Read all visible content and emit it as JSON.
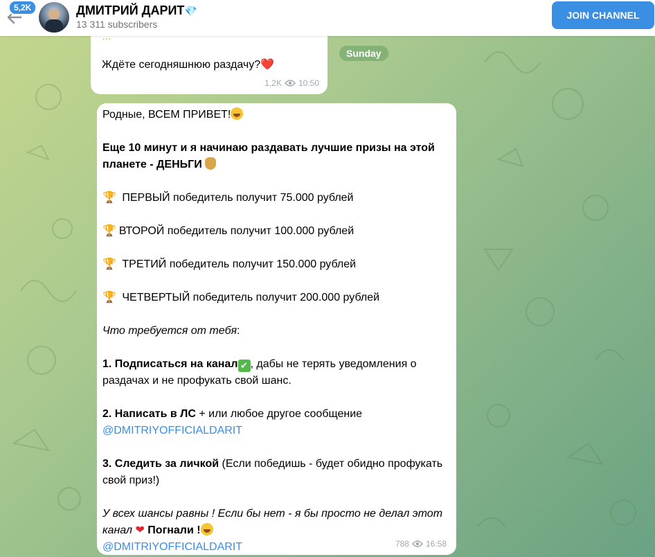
{
  "header": {
    "badge": "5,2K",
    "title": "ДМИТРИЙ ДАРИТ",
    "title_emoji": "💎",
    "subscribers": "13 311 subscribers",
    "join_label": "JOIN CHANNEL"
  },
  "date_pill": "Sunday",
  "msg1": {
    "partial": "…",
    "text": "Ждёте сегодняшнюю раздачу?",
    "emoji": "❤️",
    "views": "1,2K",
    "time": "10:50"
  },
  "msg2": {
    "greeting": "Родные, ВСЕМ ПРИВЕТ!",
    "intro": "Еще 10 минут и я начинаю раздавать лучшие призы на этой планете - ДЕНЬГИ",
    "prizes": [
      "ПЕРВЫЙ победитель получит 75.000 рублей",
      "ВТОРОЙ победитель получит 100.000 рублей",
      "ТРЕТИЙ победитель получит 150.000 рублей",
      "ЧЕТВЕРТЫЙ победитель получит 200.000 рублей"
    ],
    "requirements_label": "Что требуется от тебя",
    "req1_bold": "1. Подписаться на канал",
    "req1_rest": ", дабы не терять уведомления о раздачах и не профукать свой шанс.",
    "req2_bold": "2. Написать в ЛС",
    "req2_rest": " + или любое другое сообщение",
    "req2_link": "@DMITRIYOFFICIALDARIT",
    "req3_bold": "3. Следить за личкой",
    "req3_rest": " (Если победишь - будет обидно профукать свой приз!)",
    "closing_italic": "У всех шансы равны ! Если бы нет - я бы просто не делал этот канал",
    "closing_bold": " Погнали !",
    "closing_link": "@DMITRIYOFFICIALDARIT",
    "views": "788",
    "time": "16:58"
  }
}
